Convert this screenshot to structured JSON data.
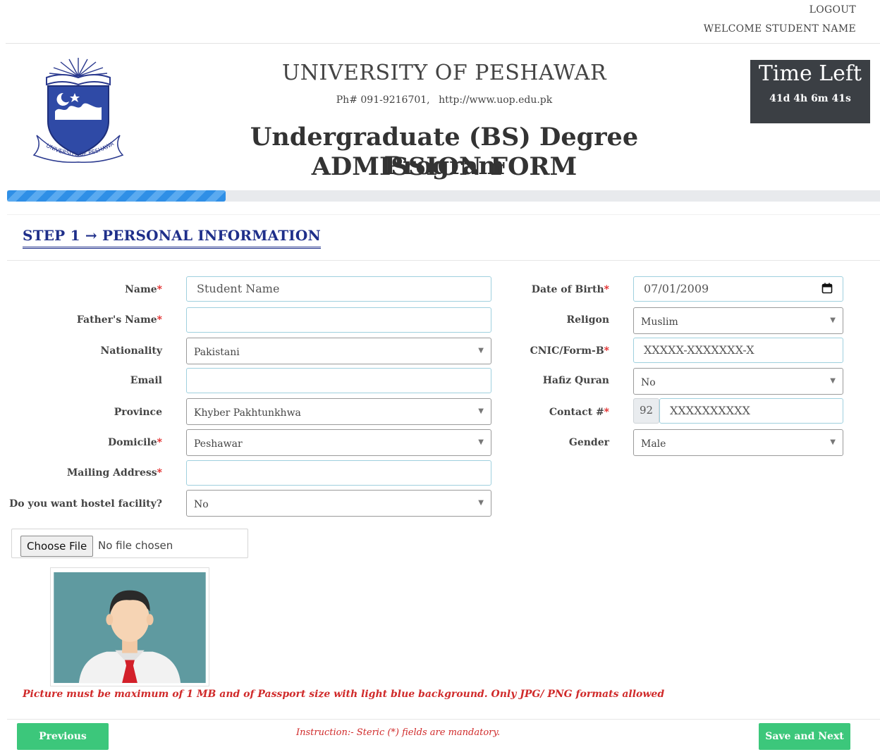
{
  "header": {
    "logout": "LOGOUT",
    "welcome": "WELCOME STUDENT NAME",
    "university": "UNIVERSITY OF PESHAWAR",
    "phone": "Ph# 091-9216701,",
    "website": "http://www.uop.edu.pk",
    "program": "Undergraduate (BS) Degree Program",
    "form_title": "ADMISSION FORM",
    "logo_text": "UNIVERSITY OF PESHAWAR"
  },
  "timer": {
    "label": "Time Left",
    "value": "41d 4h 6m 41s"
  },
  "progress": {
    "percent": 25
  },
  "step": {
    "title": "STEP 1 → PERSONAL INFORMATION"
  },
  "form": {
    "name": {
      "label": "Name",
      "value": "Student Name"
    },
    "father": {
      "label": "Father's Name",
      "value": ""
    },
    "nationality": {
      "label": "Nationality",
      "value": "Pakistani"
    },
    "email": {
      "label": "Email",
      "value": ""
    },
    "province": {
      "label": "Province",
      "value": "Khyber Pakhtunkhwa"
    },
    "domicile": {
      "label": "Domicile",
      "value": "Peshawar"
    },
    "address": {
      "label": "Mailing Address",
      "value": ""
    },
    "hostel": {
      "label": "Do you want hostel facility?",
      "value": "No"
    },
    "dob": {
      "label": "Date of Birth",
      "value": "07/01/2009"
    },
    "religion": {
      "label": "Religon",
      "value": "Muslim"
    },
    "cnic": {
      "label": "CNIC/Form-B",
      "placeholder": "XXXXX-XXXXXXX-X"
    },
    "hafiz": {
      "label": "Hafiz Quran",
      "value": "No"
    },
    "contact": {
      "label": "Contact #",
      "prefix": "92",
      "placeholder": "XXXXXXXXXX"
    },
    "gender": {
      "label": "Gender",
      "value": "Male"
    },
    "required_mark": "*"
  },
  "upload": {
    "button": "Choose File",
    "status": "No file chosen"
  },
  "photo_note": "Picture must be maximum of 1 MB and of Passport size with light blue background. Only JPG/ PNG formats allowed",
  "footer": {
    "previous": "Previous",
    "instruction": "Instruction:- Steric (*) fields are mandatory.",
    "next": "Save and Next"
  },
  "colors": {
    "accent_green": "#3cc77b",
    "title_blue": "#1f2f8a",
    "progress_blue": "#2f8fe6",
    "timer_bg": "#3b3f44",
    "error_red": "#d02a2a"
  }
}
